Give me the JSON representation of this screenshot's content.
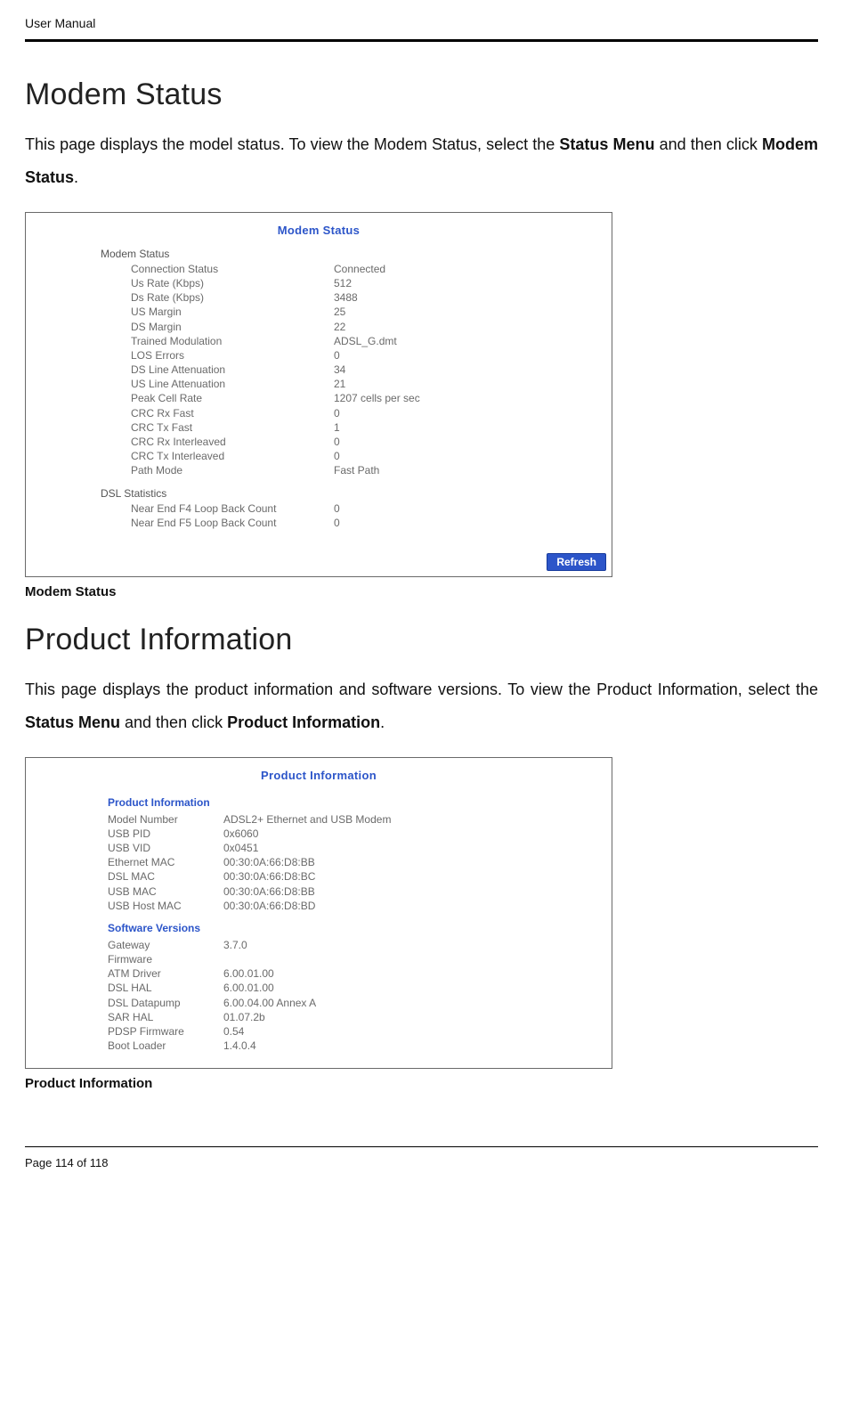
{
  "header": {
    "title": "User Manual"
  },
  "section1": {
    "heading": "Modem Status",
    "para_parts": {
      "p1a": "This page displays the model status. To view the Modem Status, select the ",
      "p1b": "Status Menu",
      "p1c": " and then click ",
      "p1d": "Modem Status",
      "p1e": "."
    },
    "panel": {
      "title": "Modem Status",
      "group1_label": "Modem Status",
      "rows1": [
        {
          "k": "Connection Status",
          "v": "Connected"
        },
        {
          "k": "Us Rate (Kbps)",
          "v": "512"
        },
        {
          "k": "Ds Rate (Kbps)",
          "v": "3488"
        },
        {
          "k": "US Margin",
          "v": "25"
        },
        {
          "k": "DS Margin",
          "v": "22"
        },
        {
          "k": "Trained Modulation",
          "v": "ADSL_G.dmt"
        },
        {
          "k": "LOS Errors",
          "v": "0"
        },
        {
          "k": "DS Line Attenuation",
          "v": "34"
        },
        {
          "k": "US Line Attenuation",
          "v": "21"
        },
        {
          "k": "Peak Cell Rate",
          "v": "1207 cells per sec"
        },
        {
          "k": "CRC Rx Fast",
          "v": "0"
        },
        {
          "k": "CRC Tx Fast",
          "v": "1"
        },
        {
          "k": "CRC Rx Interleaved",
          "v": "0"
        },
        {
          "k": "CRC Tx Interleaved",
          "v": "0"
        },
        {
          "k": "Path Mode",
          "v": "Fast Path"
        }
      ],
      "group2_label": "DSL Statistics",
      "rows2": [
        {
          "k": "Near End F4 Loop Back Count",
          "v": "0"
        },
        {
          "k": "Near End F5 Loop Back Count",
          "v": "0"
        }
      ],
      "refresh_label": "Refresh"
    },
    "caption": "Modem Status"
  },
  "section2": {
    "heading": "Product Information",
    "para_parts": {
      "p1a": "This page displays the product information and software versions. To view the Product Information, select the ",
      "p1b": "Status Menu",
      "p1c": " and then click ",
      "p1d": "Product Information",
      "p1e": "."
    },
    "panel": {
      "title": "Product Information",
      "sub1": "Product Information",
      "rows1": [
        {
          "k": "Model Number",
          "v": "ADSL2+ Ethernet and USB Modem"
        },
        {
          "k": "USB PID",
          "v": "0x6060"
        },
        {
          "k": "USB VID",
          "v": "0x0451"
        },
        {
          "k": "Ethernet MAC",
          "v": "00:30:0A:66:D8:BB"
        },
        {
          "k": "DSL MAC",
          "v": "00:30:0A:66:D8:BC"
        },
        {
          "k": "USB MAC",
          "v": "00:30:0A:66:D8:BB"
        },
        {
          "k": "USB Host MAC",
          "v": "00:30:0A:66:D8:BD"
        }
      ],
      "sub2": "Software Versions",
      "rows2": [
        {
          "k": "Gateway",
          "v": "3.7.0"
        },
        {
          "k": "Firmware",
          "v": ""
        },
        {
          "k": "ATM Driver",
          "v": "6.00.01.00"
        },
        {
          "k": "DSL HAL",
          "v": "6.00.01.00"
        },
        {
          "k": "DSL Datapump",
          "v": "6.00.04.00 Annex A"
        },
        {
          "k": "SAR HAL",
          "v": "01.07.2b"
        },
        {
          "k": "PDSP Firmware",
          "v": "0.54"
        },
        {
          "k": "Boot Loader",
          "v": "1.4.0.4"
        }
      ]
    },
    "caption": "Product Information"
  },
  "footer": {
    "page_line": "Page 114 of 118"
  }
}
